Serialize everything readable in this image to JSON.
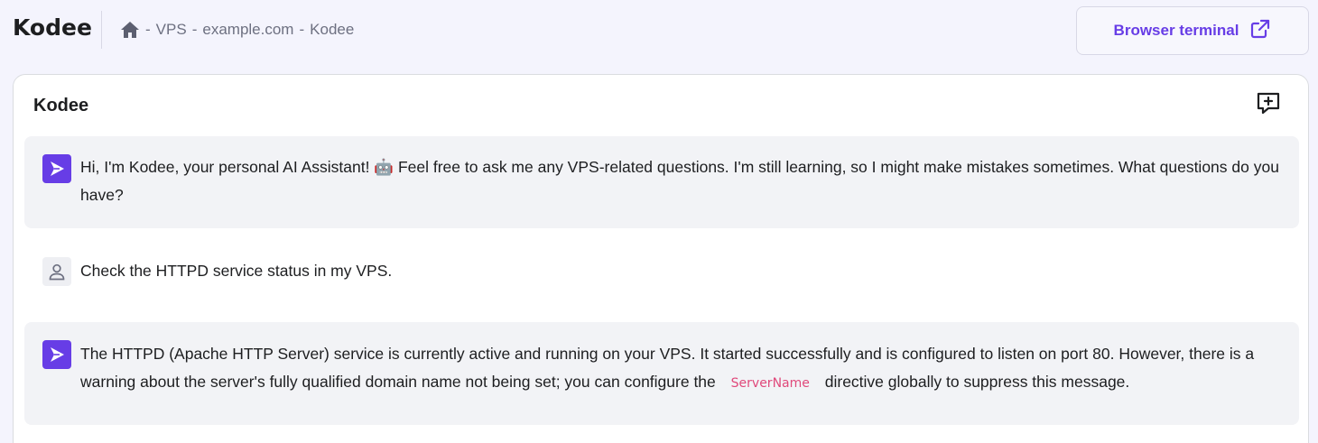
{
  "header": {
    "brand": "Kodee",
    "breadcrumb": {
      "sep1": "-",
      "item1": "VPS",
      "sep2": "-",
      "item2": "example.com",
      "sep3": "-",
      "item3": "Kodee"
    },
    "terminal_button": "Browser terminal"
  },
  "panel": {
    "title": "Kodee"
  },
  "messages": {
    "greeting": {
      "text": "Hi, I'm Kodee, your personal AI Assistant! 🤖 Feel free to ask me any VPS-related questions. I'm still learning, so I might make mistakes sometimes. What questions do you have?"
    },
    "user": {
      "text": "Check the HTTPD service status in my VPS."
    },
    "reply": {
      "text_before": "The HTTPD (Apache HTTP Server) service is currently active and running on your VPS. It started successfully and is configured to listen on port 80. However, there is a warning about the server's fully qualified domain name not being set; you can configure the",
      "code": "ServerName",
      "text_after": "directive globally to suppress this message."
    }
  },
  "colors": {
    "accent": "#673de6",
    "code": "#e0497b",
    "bot_bubble": "#f2f3f6",
    "page_bg": "#f4f4fd"
  },
  "icons": {
    "home": "home-icon",
    "external": "external-link-icon",
    "new_chat": "message-plus-icon",
    "bot": "kodee-logo-icon",
    "user": "user-icon"
  }
}
